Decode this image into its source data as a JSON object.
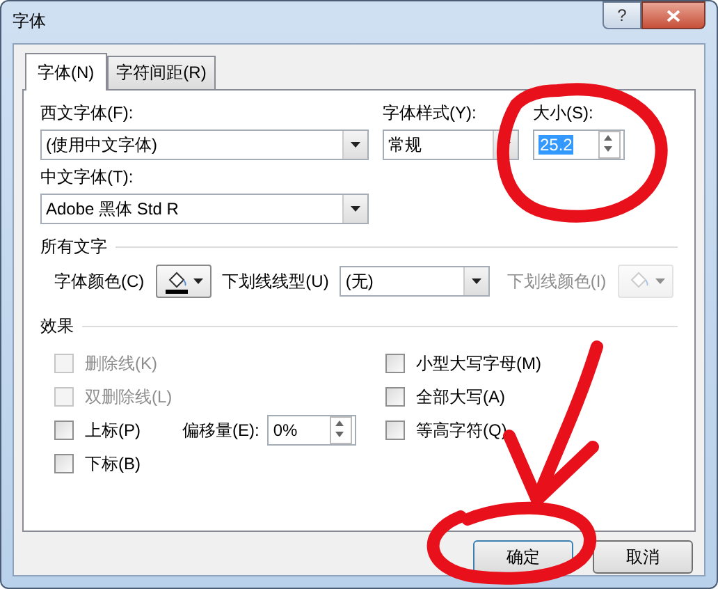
{
  "window": {
    "title": "字体",
    "help": "?"
  },
  "tabs": [
    {
      "label": "字体(N)",
      "selected": true
    },
    {
      "label": "字符间距(R)",
      "selected": false
    }
  ],
  "font": {
    "latin_label": "西文字体(F):",
    "latin_value": "(使用中文字体)",
    "style_label": "字体样式(Y):",
    "style_value": "常规",
    "size_label": "大小(S):",
    "size_value": "25.2",
    "size_selected": true,
    "asian_label": "中文字体(T):",
    "asian_value": "Adobe 黑体 Std R"
  },
  "all_text": {
    "heading": "所有文字",
    "font_color_label": "字体颜色(C)",
    "underline_style_label": "下划线线型(U)",
    "underline_style_value": "(无)",
    "underline_color_label": "下划线颜色(I)",
    "underline_color_disabled": true
  },
  "effects": {
    "heading": "效果",
    "left": [
      {
        "label": "删除线(K)",
        "checked": false,
        "disabled": true
      },
      {
        "label": "双删除线(L)",
        "checked": false,
        "disabled": true
      },
      {
        "label": "上标(P)",
        "checked": false,
        "disabled": false
      },
      {
        "label": "下标(B)",
        "checked": false,
        "disabled": false
      }
    ],
    "right": [
      {
        "label": "小型大写字母(M)",
        "checked": false,
        "disabled": false
      },
      {
        "label": "全部大写(A)",
        "checked": false,
        "disabled": false
      },
      {
        "label": "等高字符(Q)",
        "checked": false,
        "disabled": false
      }
    ],
    "offset_label": "偏移量(E):",
    "offset_value": "0%"
  },
  "buttons": [
    {
      "label": "确定",
      "default": true
    },
    {
      "label": "取消",
      "default": false
    }
  ],
  "annotations": [
    {
      "kind": "circle"
    },
    {
      "kind": "arrow"
    },
    {
      "kind": "circle"
    }
  ]
}
